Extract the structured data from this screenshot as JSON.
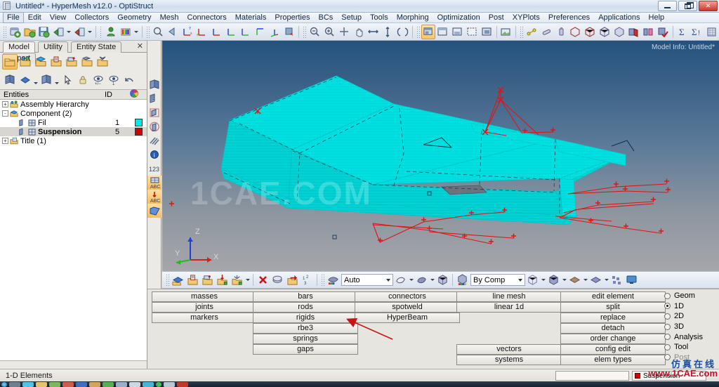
{
  "window": {
    "title": "Untitled* - HyperMesh v12.0 - OptiStruct",
    "app_icon": "hypermesh-icon",
    "minimize_label": "Minimize",
    "restore_label": "Restore",
    "close_label": "Close",
    "close_glyph": "✕"
  },
  "menubar": {
    "items": [
      {
        "label": "File"
      },
      {
        "label": "Edit"
      },
      {
        "label": "View"
      },
      {
        "label": "Collectors"
      },
      {
        "label": "Geometry"
      },
      {
        "label": "Mesh"
      },
      {
        "label": "Connectors"
      },
      {
        "label": "Materials"
      },
      {
        "label": "Properties"
      },
      {
        "label": "BCs"
      },
      {
        "label": "Setup"
      },
      {
        "label": "Tools"
      },
      {
        "label": "Morphing"
      },
      {
        "label": "Optimization"
      },
      {
        "label": "Post"
      },
      {
        "label": "XYPlots"
      },
      {
        "label": "Preferences"
      },
      {
        "label": "Applications"
      },
      {
        "label": "Help"
      }
    ]
  },
  "toolbar": {
    "groups": [
      {
        "icons": [
          "new-model-icon",
          "open-model-icon",
          "save-model-icon",
          "import-icon",
          "export-icon"
        ]
      },
      {
        "icons": [
          "user-profile-icon",
          "color-palette-icon"
        ]
      },
      {
        "icons": [
          "zoom-fit-icon",
          "back-arrow-icon",
          "axis-xy-icon",
          "axis-yx-icon",
          "axis-zx-icon",
          "axis-xz-icon",
          "axis-zy-icon",
          "axis-yz-icon",
          "axis-iso-icon",
          "rotate-view-icon"
        ]
      },
      {
        "icons": [
          "zoom-out-icon",
          "zoom-in-icon",
          "zoom-window-icon",
          "pan-icon",
          "arrow-left-right-icon",
          "arrow-up-down-icon",
          "mirror-icon"
        ]
      },
      {
        "icons": [
          "window-fit-icon",
          "window-tile-icon",
          "window-capture-icon",
          "window-dashed-icon",
          "window-solid-icon",
          "image-capture-icon"
        ]
      },
      {
        "icons": [
          "node-edit-icon",
          "line-edit-icon",
          "mass-icon",
          "shaded-box-icon",
          "wire-box-icon",
          "mesh-box-icon",
          "shaded-solid-icon",
          "section-red-icon",
          "section-pink-icon",
          "section-check-icon"
        ]
      },
      {
        "icons": [
          "summation-icon",
          "summation-warn-icon",
          "matrix-icon"
        ]
      }
    ]
  },
  "browser": {
    "tabs": [
      {
        "label": "Model",
        "selected": true
      },
      {
        "label": "Utility",
        "selected": false
      },
      {
        "label": "Entity State",
        "selected": false
      },
      {
        "label": "Import",
        "selected": false
      }
    ],
    "close_glyph": "✕",
    "toolbar_row1": [
      "folder-icon",
      "assembly-icon",
      "component-icon",
      "property-icon",
      "material-icon",
      "group-icon",
      "set-icon"
    ],
    "toolbar_row2": [
      "component-flag-icon",
      "property-shape-icon",
      "component-shape-icon",
      "pointer-icon",
      "lock-icon",
      "eye-plusminus-icon",
      "eye-one-icon",
      "undo-display-icon"
    ],
    "columns": {
      "entities": "Entities",
      "id": "ID",
      "color": "color-wheel-icon"
    },
    "tree": [
      {
        "label": "Assembly Hierarchy",
        "id": "",
        "color": "",
        "depth": 0,
        "expander": "+",
        "icon": "assembly-hierarchy-icon",
        "bold": false,
        "selected": false
      },
      {
        "label": "Component (2)",
        "id": "",
        "color": "",
        "depth": 0,
        "expander": "-",
        "icon": "component-folder-icon",
        "bold": false,
        "selected": false
      },
      {
        "label": "Fil",
        "id": "1",
        "color": "#00e8e8",
        "depth": 1,
        "expander": "",
        "icon": "component-icon",
        "bold": false,
        "selected": false
      },
      {
        "label": "Suspension",
        "id": "5",
        "color": "#d60000",
        "depth": 1,
        "expander": "",
        "icon": "component-icon",
        "bold": true,
        "selected": true
      },
      {
        "label": "Title (1)",
        "id": "",
        "color": "",
        "depth": 0,
        "expander": "+",
        "icon": "title-icon",
        "bold": false,
        "selected": false
      }
    ]
  },
  "vertical_strip": {
    "icons": [
      "component-view-icon",
      "component-mesh-icon",
      "component-frame-icon",
      "circle-component-icon",
      "lines-icon",
      "info-icon",
      "numbers-123-icon",
      "mesh-abc-icon",
      "arrow-abc-icon",
      "surface-icon"
    ]
  },
  "graphics": {
    "model_info_label": "Model Info: Untitled*",
    "watermark": "1CAE.COM",
    "background_top": "#24527f",
    "background_bottom": "#a6a6ab",
    "mesh_color": "#00e8e8",
    "element_color": "#e01414",
    "triad": {
      "x_label": "X",
      "y_label": "Y",
      "z_label": "Z",
      "x_color": "#d22020",
      "y_color": "#22b822",
      "z_color": "#2040d8"
    }
  },
  "graphics_toolbar": {
    "icons_left": [
      "component-blue-icon",
      "property-icon",
      "material-icon",
      "load-icon",
      "system-icon"
    ],
    "icons_mid": [
      "delete-red-icon",
      "mask-icon",
      "reverse-icon",
      "renumber-icon"
    ],
    "visual_mode": {
      "value": "Auto",
      "name": "visual-mode-combo"
    },
    "icons_right1": [
      "shading-icon",
      "shading-2-icon",
      "cube-icon"
    ],
    "color_mode": {
      "value": "By Comp",
      "name": "color-mode-combo"
    },
    "icons_right2": [
      "wireframe-cube-icon",
      "shaded-cube-icon",
      "diamond-icon",
      "plate-icon",
      "elements-icon",
      "screen-icon"
    ]
  },
  "panel": {
    "buttons": [
      {
        "label": "masses",
        "col": 0,
        "row": 0
      },
      {
        "label": "joints",
        "col": 0,
        "row": 1
      },
      {
        "label": "markers",
        "col": 0,
        "row": 2
      },
      {
        "label": "bars",
        "col": 1,
        "row": 0
      },
      {
        "label": "rods",
        "col": 1,
        "row": 1
      },
      {
        "label": "rigids",
        "col": 1,
        "row": 2
      },
      {
        "label": "rbe3",
        "col": 1,
        "row": 3
      },
      {
        "label": "springs",
        "col": 1,
        "row": 4
      },
      {
        "label": "gaps",
        "col": 1,
        "row": 5
      },
      {
        "label": "connectors",
        "col": 2,
        "row": 0
      },
      {
        "label": "spotweld",
        "col": 2,
        "row": 1
      },
      {
        "label": "HyperBeam",
        "col": 2,
        "row": 2
      },
      {
        "label": "line mesh",
        "col": 3,
        "row": 0
      },
      {
        "label": "linear 1d",
        "col": 3,
        "row": 1
      },
      {
        "label": "vectors",
        "col": 3,
        "row": 5
      },
      {
        "label": "systems",
        "col": 3,
        "row": 6
      },
      {
        "label": "edit element",
        "col": 4,
        "row": 0
      },
      {
        "label": "split",
        "col": 4,
        "row": 1
      },
      {
        "label": "replace",
        "col": 4,
        "row": 2
      },
      {
        "label": "detach",
        "col": 4,
        "row": 3
      },
      {
        "label": "order change",
        "col": 4,
        "row": 4
      },
      {
        "label": "config edit",
        "col": 4,
        "row": 5
      },
      {
        "label": "elem types",
        "col": 4,
        "row": 6
      }
    ],
    "radios": [
      {
        "label": "Geom",
        "selected": false,
        "dim": false
      },
      {
        "label": "1D",
        "selected": true,
        "dim": false
      },
      {
        "label": "2D",
        "selected": false,
        "dim": false
      },
      {
        "label": "3D",
        "selected": false,
        "dim": false
      },
      {
        "label": "Analysis",
        "selected": false,
        "dim": false
      },
      {
        "label": "Tool",
        "selected": false,
        "dim": false
      },
      {
        "label": "Post",
        "selected": false,
        "dim": true
      }
    ],
    "annotation": {
      "name": "red-arrow-annotation",
      "target": "rigids",
      "color": "#c81414"
    }
  },
  "statusbar": {
    "message": "1-D Elements",
    "current_component": "Suspension",
    "component_color": "#d60000",
    "brand": "www.1CAE.com",
    "brand_cn": "仿真在线"
  },
  "taskbar": {
    "items": [
      "start-orb",
      "ie-icon",
      "folder-icon",
      "explorer-icon",
      "check-icon",
      "media-icon",
      "blue-app-icon",
      "person-icon",
      "green-app-icon",
      "doc-icon",
      "envelope-icon",
      "teal-app-icon",
      "green-circle-icon",
      "image-icon",
      "red-book-icon"
    ]
  }
}
